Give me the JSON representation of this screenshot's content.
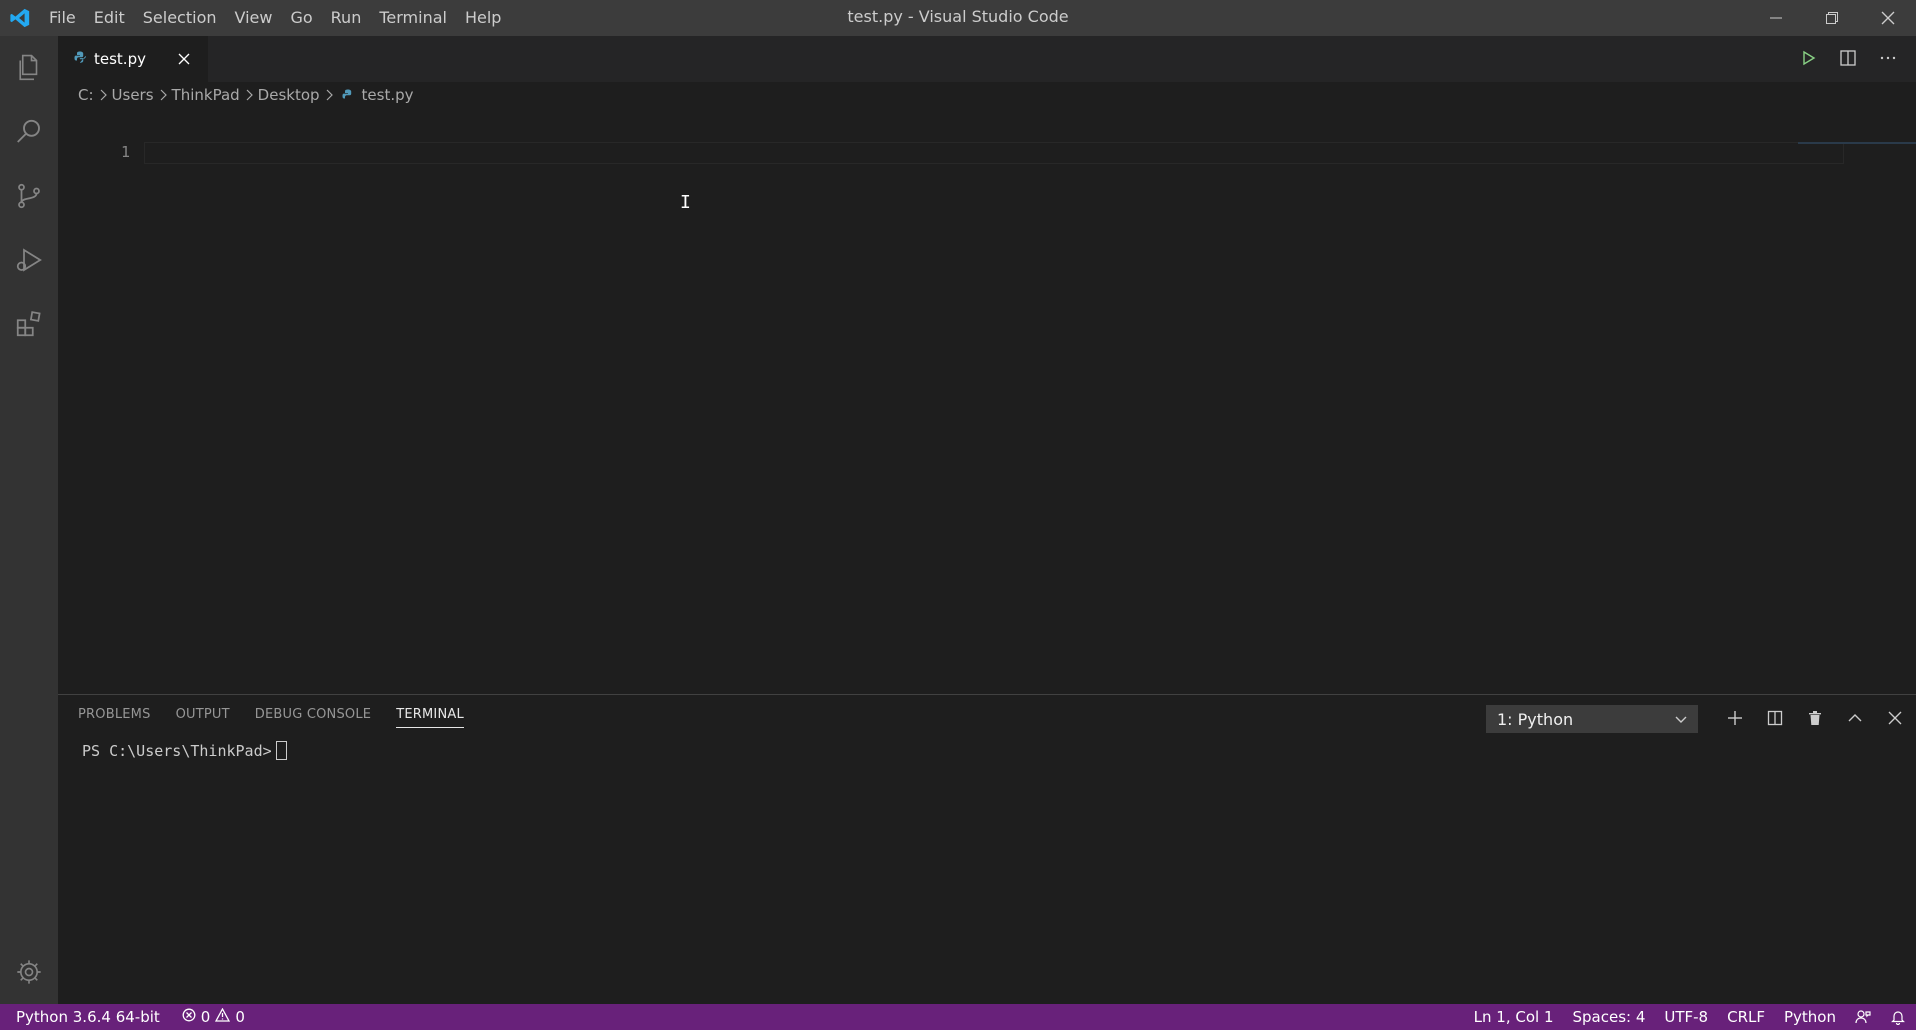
{
  "window": {
    "title": "test.py - Visual Studio Code",
    "menu": [
      "File",
      "Edit",
      "Selection",
      "View",
      "Go",
      "Run",
      "Terminal",
      "Help"
    ]
  },
  "activity_bar": {
    "items": [
      "explorer-icon",
      "search-icon",
      "source-control-icon",
      "run-debug-icon",
      "extensions-icon"
    ],
    "bottom": "gear-icon"
  },
  "editor": {
    "tab": {
      "label": "test.py",
      "icon": "python-file-icon"
    },
    "breadcrumb": [
      "C:",
      "Users",
      "ThinkPad",
      "Desktop",
      "test.py"
    ],
    "line_numbers": [
      "1"
    ]
  },
  "panel": {
    "tabs": [
      "PROBLEMS",
      "OUTPUT",
      "DEBUG CONSOLE",
      "TERMINAL"
    ],
    "active_tab": "TERMINAL",
    "terminal_select": "1: Python",
    "terminal_prompt": "PS C:\\Users\\ThinkPad>"
  },
  "status_bar": {
    "interpreter": "Python 3.6.4 64-bit",
    "errors": "0",
    "warnings": "0",
    "position": "Ln 1, Col 1",
    "spaces": "Spaces: 4",
    "encoding": "UTF-8",
    "eol": "CRLF",
    "language": "Python",
    "color": "#68217a"
  }
}
